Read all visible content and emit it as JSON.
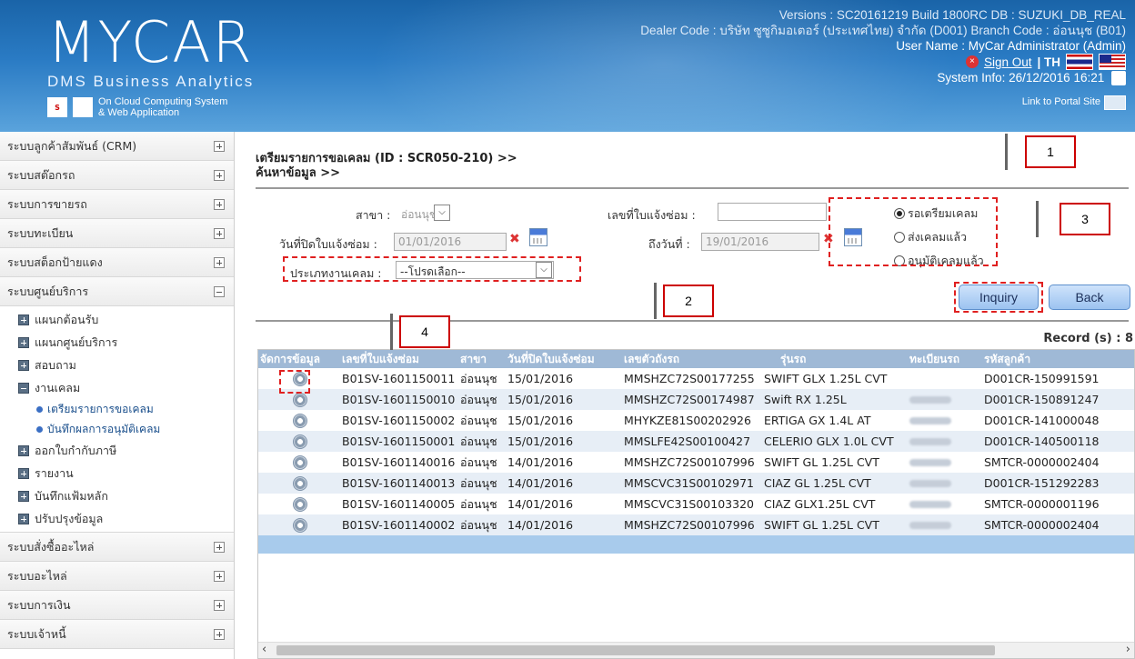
{
  "header": {
    "logo": "MYCAR",
    "logo_sub": "DMS Business Analytics",
    "logo_tagline1": "On Cloud Computing System",
    "logo_tagline2": "& Web Application",
    "version_line": "Versions : SC20161219 Build 1800RC DB : SUZUKI_DB_REAL",
    "dealer_line": "Dealer Code : บริษัท ซูซูกิมอเตอร์ (ประเทศไทย) จำกัด (D001)  Branch Code : อ่อนนุช (B01)",
    "user_line": "User Name : MyCar Administrator  (Admin)",
    "sign_out": "Sign Out",
    "lang": "| TH",
    "system_info": "System Info: 26/12/2016 16:21",
    "portal": "Link to Portal Site"
  },
  "sidebar": {
    "groups_top": [
      "ระบบลูกค้าสัมพันธ์ (CRM)",
      "ระบบสต๊อกรถ",
      "ระบบการขายรถ",
      "ระบบทะเบียน",
      "ระบบสต็อกป้ายแดง",
      "ระบบศูนย์บริการ"
    ],
    "sub_items": [
      "แผนกต้อนรับ",
      "แผนกศูนย์บริการ",
      "สอบถาม",
      "งานเคลม",
      "เตรียมรายการขอเคลม",
      "บันทึกผลการอนุมัติเคลม",
      "ออกใบกำกับภาษี",
      "รายงาน",
      "บันทึกแฟ้มหลัก",
      "ปรับปรุงข้อมูล"
    ],
    "groups_bottom": [
      "ระบบสั่งซื้ออะไหล่",
      "ระบบอะไหล่",
      "ระบบการเงิน",
      "ระบบเจ้าหนี้"
    ]
  },
  "page": {
    "title1": "เตรียมรายการขอเคลม (ID : SCR050-210) >>",
    "title2": "ค้นหาข้อมูล >>"
  },
  "form": {
    "branch_label": "สาขา :",
    "branch_value": "อ่อนนุช",
    "repair_no_label": "เลขที่ใบแจ้งซ่อม :",
    "repair_no_value": "",
    "close_date_label": "วันที่ปิดใบแจ้งซ่อม :",
    "close_date_value": "01/01/2016",
    "to_date_label": "ถึงวันที่ :",
    "to_date_value": "19/01/2016",
    "claim_type_label": "ประเภทงานเคลม :",
    "claim_type_value": "--โปรดเลือก--",
    "radios": [
      "รอเตรียมเคลม",
      "ส่งเคลมแล้ว",
      "อนุมัติเคลมแล้ว"
    ],
    "inquiry": "Inquiry",
    "back": "Back"
  },
  "record": "Record (s) : 8",
  "table": {
    "headers": [
      "จัดการข้อมูล",
      "เลขที่ใบแจ้งซ่อม",
      "สาขา",
      "วันที่ปิดใบแจ้งซ่อม",
      "เลขตัวถังรถ",
      "รุ่นรถ",
      "ทะเบียนรถ",
      "รหัสลูกค้า"
    ],
    "rows": [
      [
        "B01SV-1601150011",
        "อ่อนนุช",
        "15/01/2016",
        "MMSHZC72S00177255",
        "SWIFT GLX 1.25L CVT",
        "",
        "D001CR-150991591"
      ],
      [
        "B01SV-1601150010",
        "อ่อนนุช",
        "15/01/2016",
        "MMSHZC72S00174987",
        "Swift RX 1.25L",
        "",
        "D001CR-150891247"
      ],
      [
        "B01SV-1601150002",
        "อ่อนนุช",
        "15/01/2016",
        "MHYKZE81S00202926",
        "ERTIGA GX 1.4L AT",
        "",
        "D001CR-141000048"
      ],
      [
        "B01SV-1601150001",
        "อ่อนนุช",
        "15/01/2016",
        "MMSLFE42S00100427",
        "CELERIO GLX 1.0L CVT",
        "",
        "D001CR-140500118"
      ],
      [
        "B01SV-1601140016",
        "อ่อนนุช",
        "14/01/2016",
        "MMSHZC72S00107996",
        "SWIFT GL 1.25L CVT",
        "",
        "SMTCR-0000002404"
      ],
      [
        "B01SV-1601140013",
        "อ่อนนุช",
        "14/01/2016",
        "MMSCVC31S00102971",
        "CIAZ GL 1.25L CVT",
        "",
        "D001CR-151292283"
      ],
      [
        "B01SV-1601140005",
        "อ่อนนุช",
        "14/01/2016",
        "MMSCVC31S00103320",
        "CIAZ GLX1.25L CVT",
        "",
        "SMTCR-0000001196"
      ],
      [
        "B01SV-1601140002",
        "อ่อนนุช",
        "14/01/2016",
        "MMSHZC72S00107996",
        "SWIFT GL 1.25L CVT",
        "",
        "SMTCR-0000002404"
      ]
    ]
  },
  "callouts": [
    "1",
    "2",
    "3",
    "4"
  ]
}
